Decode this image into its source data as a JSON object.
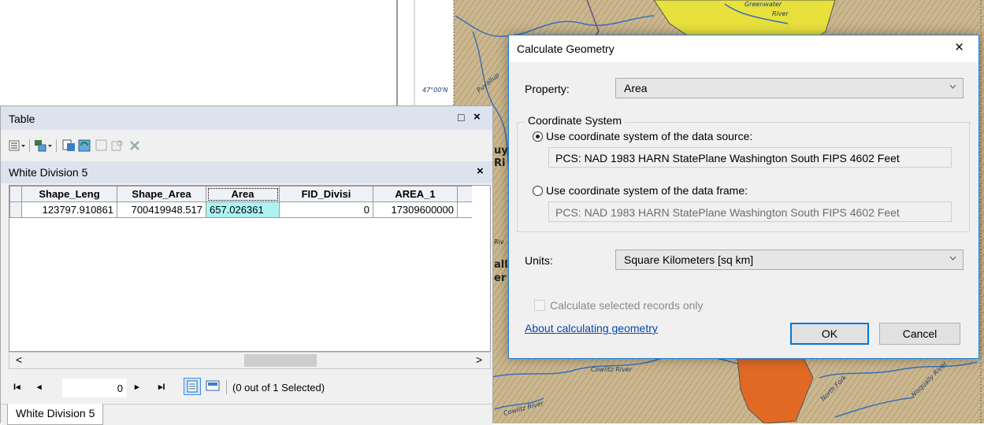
{
  "map": {
    "labels": {
      "greenwater": "Greenwater",
      "river_top": "River",
      "coord_left": "47°00'N",
      "puyallup_partial": "Puyallup",
      "cowlitz_a": "Cowlitz River",
      "cowlitz_b": "Cowlitz River",
      "north_fork": "North Fork",
      "nisqually_partial": "Nisqually River",
      "side_a": "uya",
      "side_b": "Ri",
      "side_c": "all",
      "side_d": "er",
      "side_e": "Riv"
    },
    "colors": {
      "terrain": "#c9b58d",
      "river": "#3a6fb5",
      "yellow_basin": "#e8e03c",
      "orange_basin": "#e06a24"
    }
  },
  "table_window": {
    "title": "Table",
    "title_buttons": {
      "restore": "□",
      "close": "×"
    },
    "toolbar_icons": [
      "table-options-icon",
      "related-tables-icon",
      "select-by-attributes-icon",
      "switch-selection-icon",
      "clear-selection-icon",
      "zoom-to-selected-icon",
      "delete-selected-icon"
    ],
    "subtitle": "White Division 5",
    "subtitle_close": "×",
    "columns": [
      "Shape_Leng",
      "Shape_Area",
      "Area",
      "FID_Divisi",
      "AREA_1"
    ],
    "rows": [
      [
        "123797.910861",
        "700419948.517",
        "657.026361",
        "0",
        "17309600000"
      ]
    ],
    "selected_column": "Area",
    "scroll": {
      "left": "<",
      "right": ">"
    },
    "nav": {
      "first": "I◂",
      "prev": "◂",
      "record": "0",
      "next": "▸",
      "last": "▸I"
    },
    "selection_status": "(0 out of 1 Selected)",
    "tab_label": "White Division 5"
  },
  "dialog": {
    "title": "Calculate Geometry",
    "close": "×",
    "property_label": "Property:",
    "property_value": "Area",
    "coord_group_label": "Coordinate System",
    "radio_source_label": "Use coordinate system of the data source:",
    "radio_source_selected": true,
    "source_cs": "PCS: NAD 1983 HARN StatePlane Washington South FIPS 4602 Feet",
    "radio_frame_label": "Use coordinate system of the data frame:",
    "frame_cs": "PCS: NAD 1983 HARN StatePlane Washington South FIPS 4602 Feet",
    "units_label": "Units:",
    "units_value": "Square Kilometers [sq km]",
    "selected_only_label": "Calculate selected records only",
    "help_link": "About calculating geometry",
    "ok": "OK",
    "cancel": "Cancel"
  }
}
